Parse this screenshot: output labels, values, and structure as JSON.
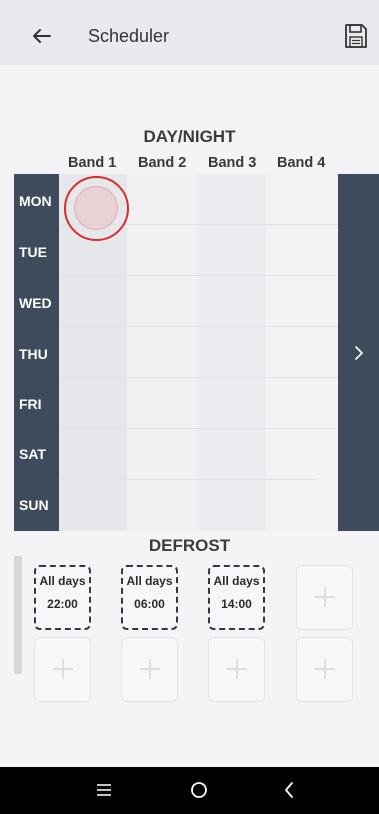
{
  "app_bar": {
    "title": "Scheduler",
    "back_icon": "arrow-left-icon",
    "save_icon": "floppy-disk-icon"
  },
  "day_night": {
    "title": "DAY/NIGHT",
    "bands": [
      "Band 1",
      "Band 2",
      "Band 3",
      "Band 4"
    ],
    "days": [
      "MON",
      "TUE",
      "WED",
      "THU",
      "FRI",
      "SAT",
      "SUN"
    ],
    "next_icon": "chevron-right-icon"
  },
  "defrost": {
    "title": "DEFROST",
    "slots": [
      {
        "days": "All days",
        "time": "22:00"
      },
      {
        "days": "All days",
        "time": "06:00"
      },
      {
        "days": "All days",
        "time": "14:00"
      }
    ],
    "add_icon": "plus-icon"
  },
  "nav_bar": {
    "recents_icon": "menu-lines-icon",
    "home_icon": "circle-home-icon",
    "back_icon": "chevron-left-icon"
  },
  "colors": {
    "accent_dark": "#3f4b5c",
    "touch_marker": "#d32f2f"
  }
}
